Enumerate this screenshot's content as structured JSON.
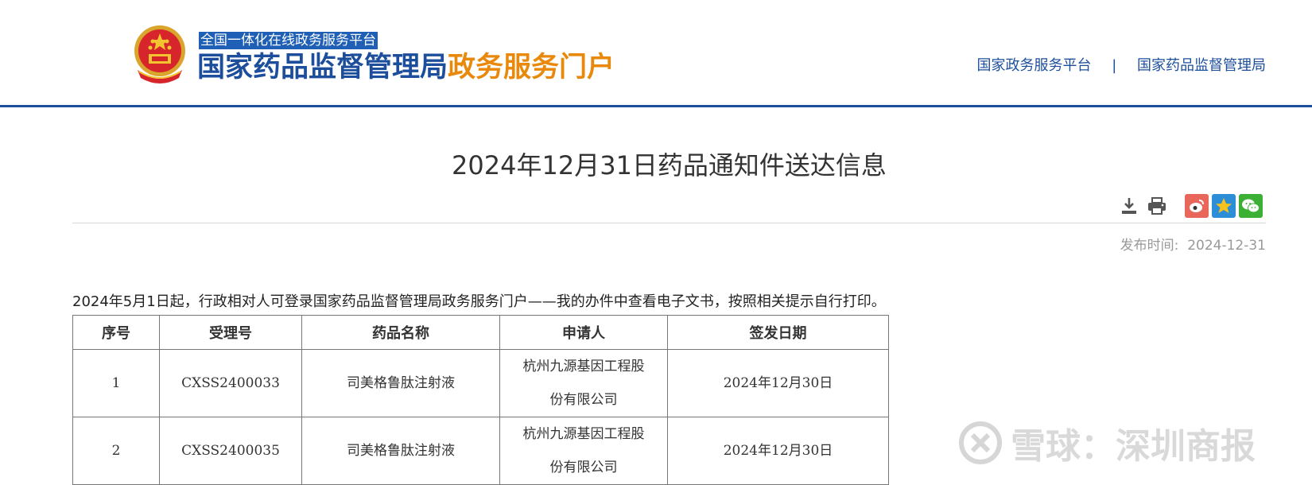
{
  "header": {
    "platform_tag": "全国一体化在线政务服务平台",
    "title_blue": "国家药品监督管理局",
    "title_orange": "政务服务门户",
    "links": [
      "国家政务服务平台",
      "国家药品监督管理局"
    ],
    "separator": "|"
  },
  "article": {
    "title": "2024年12月31日药品通知件送达信息",
    "publish_label": "发布时间:",
    "publish_date": "2024-12-31",
    "notice": "2024年5月1日起，行政相对人可登录国家药品监督管理局政务服务门户——我的办件中查看电子文书，按照相关提示自行打印。"
  },
  "toolbar": {
    "icons": [
      "download-icon",
      "print-icon",
      "weibo-icon",
      "favorite-icon",
      "wechat-icon"
    ],
    "colors": {
      "weibo": "#e8675a",
      "favorite": "#2d8ed8",
      "wechat": "#3cb034",
      "gray": "#555555"
    }
  },
  "table": {
    "headers": [
      "序号",
      "受理号",
      "药品名称",
      "申请人",
      "签发日期"
    ],
    "rows": [
      {
        "no": "1",
        "accept_no": "CXSS2400033",
        "drug": "司美格鲁肽注射液",
        "applicant_l1": "杭州九源基因工程股",
        "applicant_l2": "份有限公司",
        "date": "2024年12月30日"
      },
      {
        "no": "2",
        "accept_no": "CXSS2400035",
        "drug": "司美格鲁肽注射液",
        "applicant_l1": "杭州九源基因工程股",
        "applicant_l2": "份有限公司",
        "date": "2024年12月30日"
      }
    ]
  },
  "watermark": {
    "text": "雪球：深圳商报"
  },
  "colors": {
    "brand_blue": "#1c4e9c",
    "brand_orange": "#e8890c"
  }
}
